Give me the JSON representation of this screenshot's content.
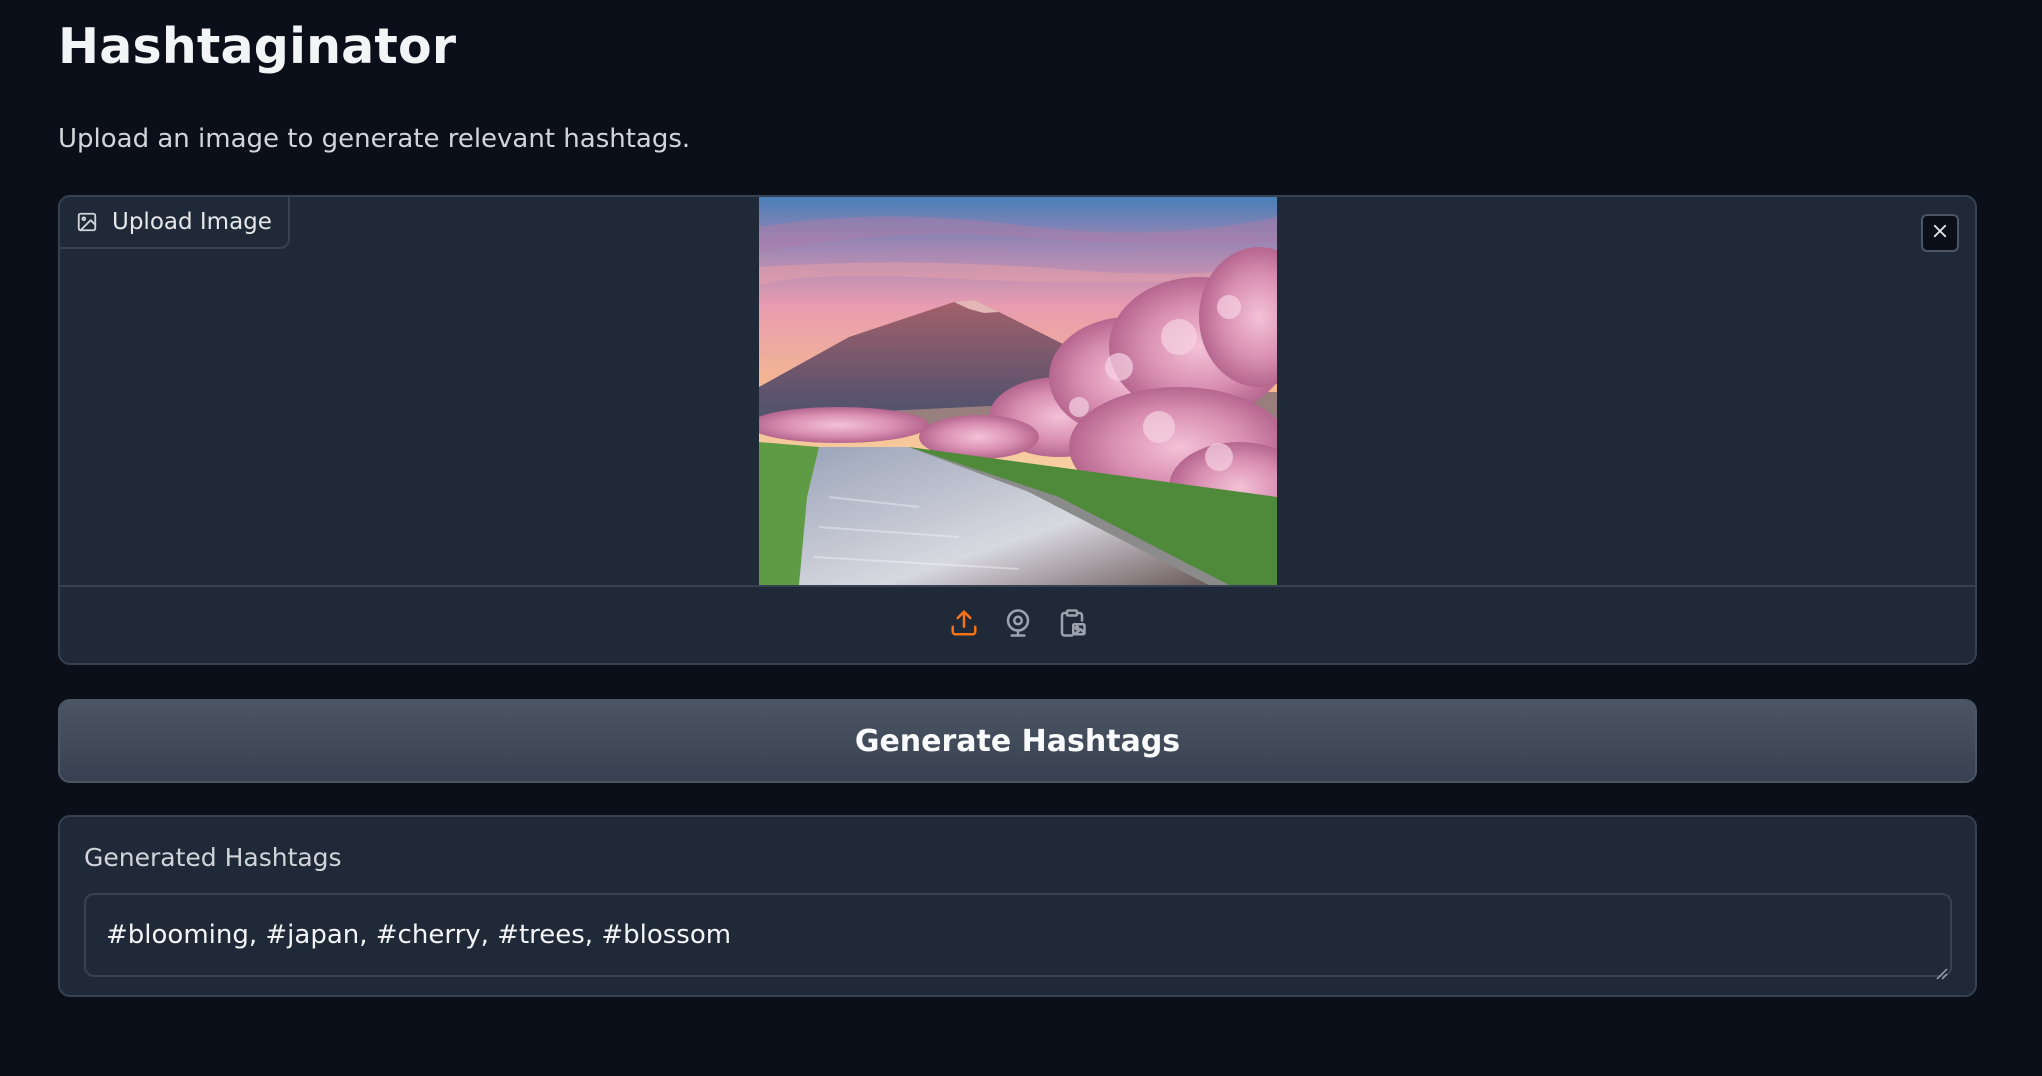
{
  "app": {
    "title": "Hashtaginator",
    "description": "Upload an image to generate relevant hashtags."
  },
  "image_input": {
    "label": "Upload Image",
    "icon": "image-icon",
    "clear_icon": "close-icon",
    "sources": [
      {
        "name": "upload-icon",
        "active": true
      },
      {
        "name": "webcam-icon",
        "active": false
      },
      {
        "name": "clipboard-icon",
        "active": false
      }
    ]
  },
  "actions": {
    "generate_label": "Generate Hashtags"
  },
  "output": {
    "label": "Generated Hashtags",
    "value": "#blooming, #japan, #cherry, #trees, #blossom"
  },
  "colors": {
    "background": "#0b0f19",
    "panel": "#1f2937",
    "border": "#374151",
    "accent": "#f97316"
  }
}
